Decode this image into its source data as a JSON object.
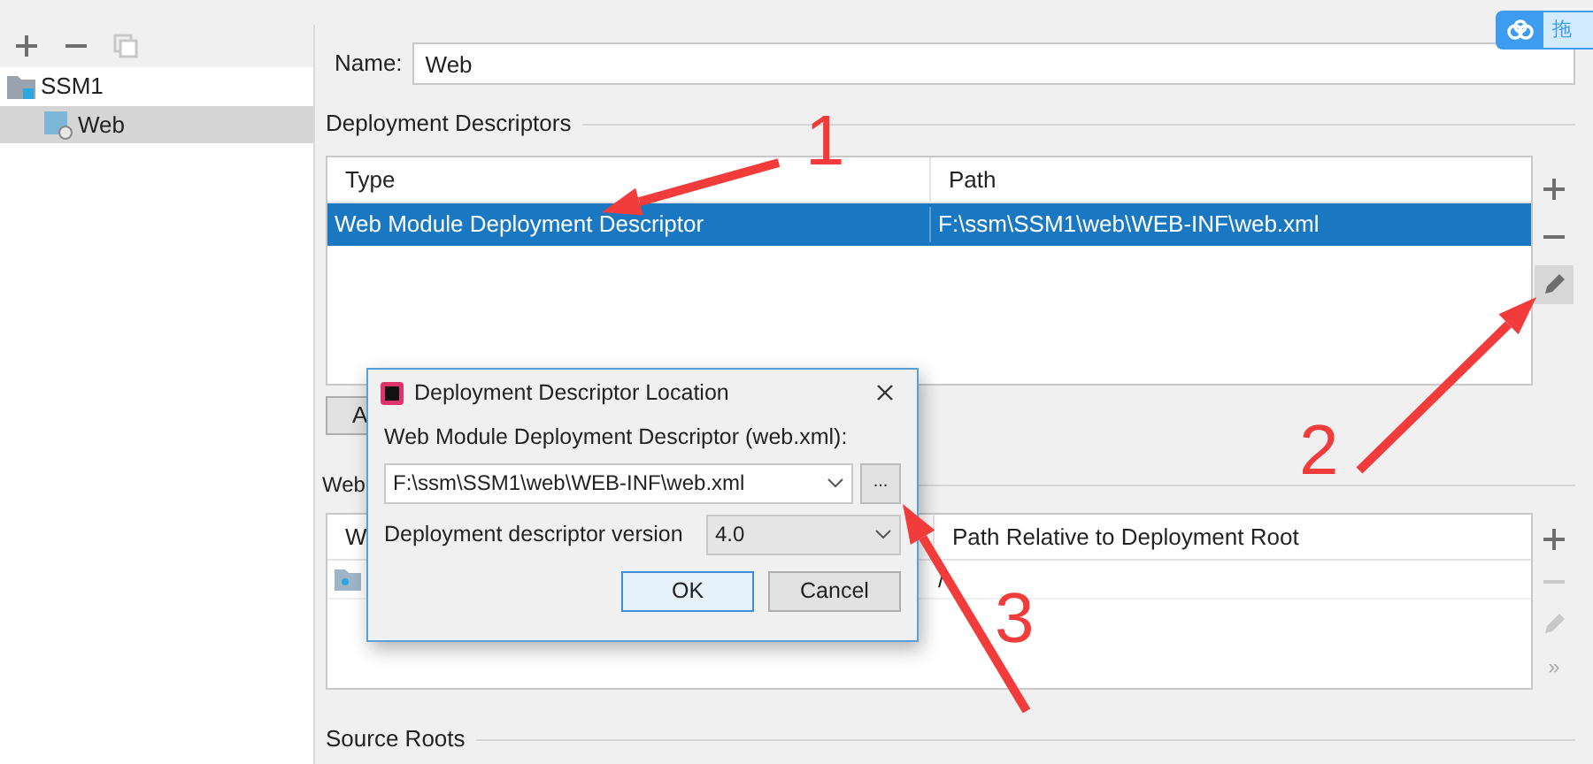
{
  "sidebar": {
    "toolbar": [
      {
        "kind": "add",
        "disabled": false
      },
      {
        "kind": "remove",
        "disabled": false
      },
      {
        "kind": "copy",
        "disabled": true
      }
    ],
    "tree": [
      {
        "label": "SSM1",
        "kind": "module",
        "selected": false,
        "children": [
          {
            "label": "Web",
            "kind": "web",
            "selected": true
          }
        ]
      }
    ]
  },
  "name_field": {
    "label": "Name:",
    "value": "Web"
  },
  "deployment_descriptors": {
    "title": "Deployment Descriptors",
    "columns": [
      "Type",
      "Path"
    ],
    "rows": [
      {
        "type": "Web Module Deployment Descriptor",
        "path": "F:\\ssm\\SSM1\\web\\WEB-INF\\web.xml",
        "selected": true
      }
    ],
    "toolbar": [
      {
        "kind": "add",
        "disabled": false,
        "hovered": false
      },
      {
        "kind": "remove",
        "disabled": false,
        "hovered": false
      },
      {
        "kind": "edit",
        "disabled": false,
        "hovered": true
      }
    ],
    "add_button": "A"
  },
  "web_resource_directories": {
    "title": "Web",
    "columns": [
      "W",
      "Path Relative to Deployment Root"
    ],
    "rows": [
      {
        "path": "/",
        "selected": false
      }
    ],
    "toolbar": [
      {
        "kind": "add",
        "disabled": false
      },
      {
        "kind": "remove",
        "disabled": true
      },
      {
        "kind": "edit",
        "disabled": true
      },
      {
        "kind": "more",
        "label": "»",
        "disabled": true
      }
    ]
  },
  "source_roots": {
    "title": "Source Roots"
  },
  "dialog": {
    "title": "Deployment Descriptor Location",
    "path_label": "Web Module Deployment Descriptor (web.xml):",
    "path_value": "F:\\ssm\\SSM1\\web\\WEB-INF\\web.xml",
    "browse_label": "...",
    "version_label": "Deployment descriptor version",
    "version_value": "4.0",
    "buttons": [
      {
        "label": "OK",
        "default": true
      },
      {
        "label": "Cancel",
        "default": false
      }
    ]
  },
  "annotations": [
    {
      "number": "1"
    },
    {
      "number": "2"
    },
    {
      "number": "3"
    }
  ],
  "overlay_badge": {
    "label": "拖"
  }
}
